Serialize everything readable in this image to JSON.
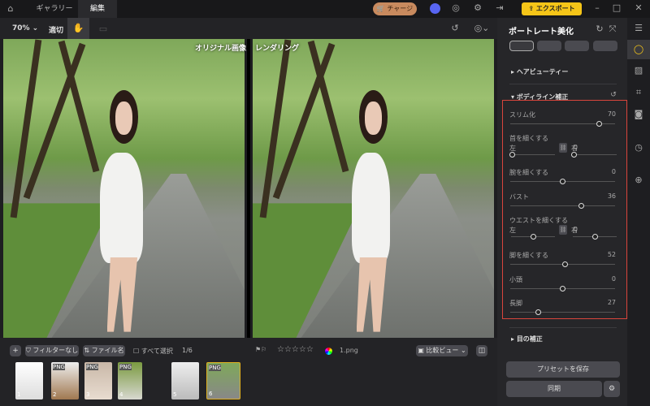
{
  "tabs": [
    {
      "label": "ギャラリー"
    },
    {
      "label": "編集"
    }
  ],
  "header": {
    "charge": "チャージ",
    "export": "エクスポート",
    "accent": "#f5c518"
  },
  "toolbar": {
    "zoom": "70%",
    "fit": "適切"
  },
  "labels": {
    "original": "オリジナル画像",
    "rendered": "レンダリング"
  },
  "panel": {
    "title": "ポートレート美化",
    "sections": {
      "hair": "ヘアビューティー",
      "body": "ボディライン補正",
      "eyes": "目の補正"
    },
    "sliders": {
      "slim": {
        "label": "スリム化",
        "value": 70
      },
      "neck": {
        "label": "首を細くする",
        "left_label": "左",
        "left": 0,
        "right_label": "右",
        "right": 0
      },
      "arm": {
        "label": "腕を細くする",
        "value": 0
      },
      "bust": {
        "label": "バスト",
        "value": 36
      },
      "waist": {
        "label": "ウエストを細くする",
        "left_label": "左",
        "left": 0,
        "right_label": "右",
        "right": 0
      },
      "leg": {
        "label": "脚を細くする",
        "value": 52
      },
      "head": {
        "label": "小頭",
        "value": 0
      },
      "longleg": {
        "label": "長脚",
        "value": 27
      }
    },
    "save_preset": "プリセットを保存",
    "sync": "同期"
  },
  "bottom": {
    "filter": "フィルターなし",
    "sort": "ファイル名",
    "select_all": "すべて選択",
    "count": "1/6",
    "filename": "1.png",
    "compare": "比較ビュー"
  },
  "thumbnails": [
    {
      "n": "1",
      "badge": ""
    },
    {
      "n": "2",
      "badge": "PNG"
    },
    {
      "n": "3",
      "badge": "PNG"
    },
    {
      "n": "4",
      "badge": "PNG"
    },
    {
      "n": "5",
      "badge": ""
    },
    {
      "n": "6",
      "badge": "PNG"
    }
  ]
}
